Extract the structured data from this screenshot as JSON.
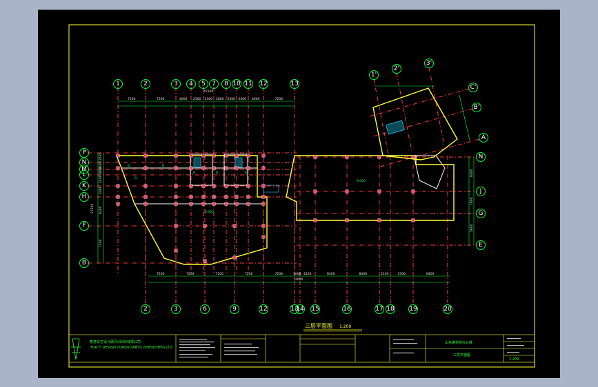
{
  "drawing": {
    "title": "三层平面图",
    "scale": "1:200",
    "total_width_dim": "72000",
    "top_width_dim": "42300",
    "right_height_dim": "27300"
  },
  "axes": {
    "top_numbers": [
      "1",
      "2",
      "3",
      "4",
      "5",
      "7",
      "8",
      "10",
      "11",
      "12",
      "13"
    ],
    "bottom_numbers": [
      "2",
      "3",
      "6",
      "9",
      "12",
      "13",
      "14",
      "15",
      "16",
      "17",
      "18",
      "19",
      "20"
    ],
    "left_letters": [
      "P",
      "N",
      "M",
      "L",
      "K",
      "H",
      "F",
      "B"
    ],
    "right_letters": [
      "N",
      "J",
      "G",
      "E"
    ],
    "tower_numbers": [
      "1'",
      "2'",
      "3'"
    ],
    "tower_letters": [
      "C'",
      "B'",
      "A"
    ]
  },
  "dimensions": {
    "top": [
      "7200",
      "7200",
      "4000",
      "2300",
      "2300",
      "2800",
      "2300",
      "2300",
      "4000",
      "7200"
    ],
    "bottom": [
      "7200",
      "7200",
      "7200",
      "7200",
      "7200",
      "1000",
      "4200",
      "8400",
      "8400",
      "2100",
      "5300",
      "8400"
    ],
    "left": [
      "2500",
      "4000",
      "2800",
      "2400",
      "2000",
      "6300",
      "7200",
      "5800"
    ],
    "right": [
      "8400",
      "7800",
      "5800"
    ]
  },
  "rooms": {
    "large_hall_tag": "3.000",
    "east_hall_tag": "3.000",
    "room_prefix": "B"
  },
  "title_block": {
    "company_cn": "香港华艺设计顾问(深圳)有限公司",
    "company_en": "HUA YI DESIGN CONSULTANTS (SHENZHEN) LTD.",
    "project_name": "山东某科技办公楼",
    "sheet_name": "三层平面图",
    "scale": "1:200"
  },
  "colors": {
    "background": "#000000",
    "axis": "#ff3a3a",
    "dimension": "#00ff44",
    "wall": "#ffff33",
    "column": "#ff4466",
    "frame": "#ffff33"
  }
}
